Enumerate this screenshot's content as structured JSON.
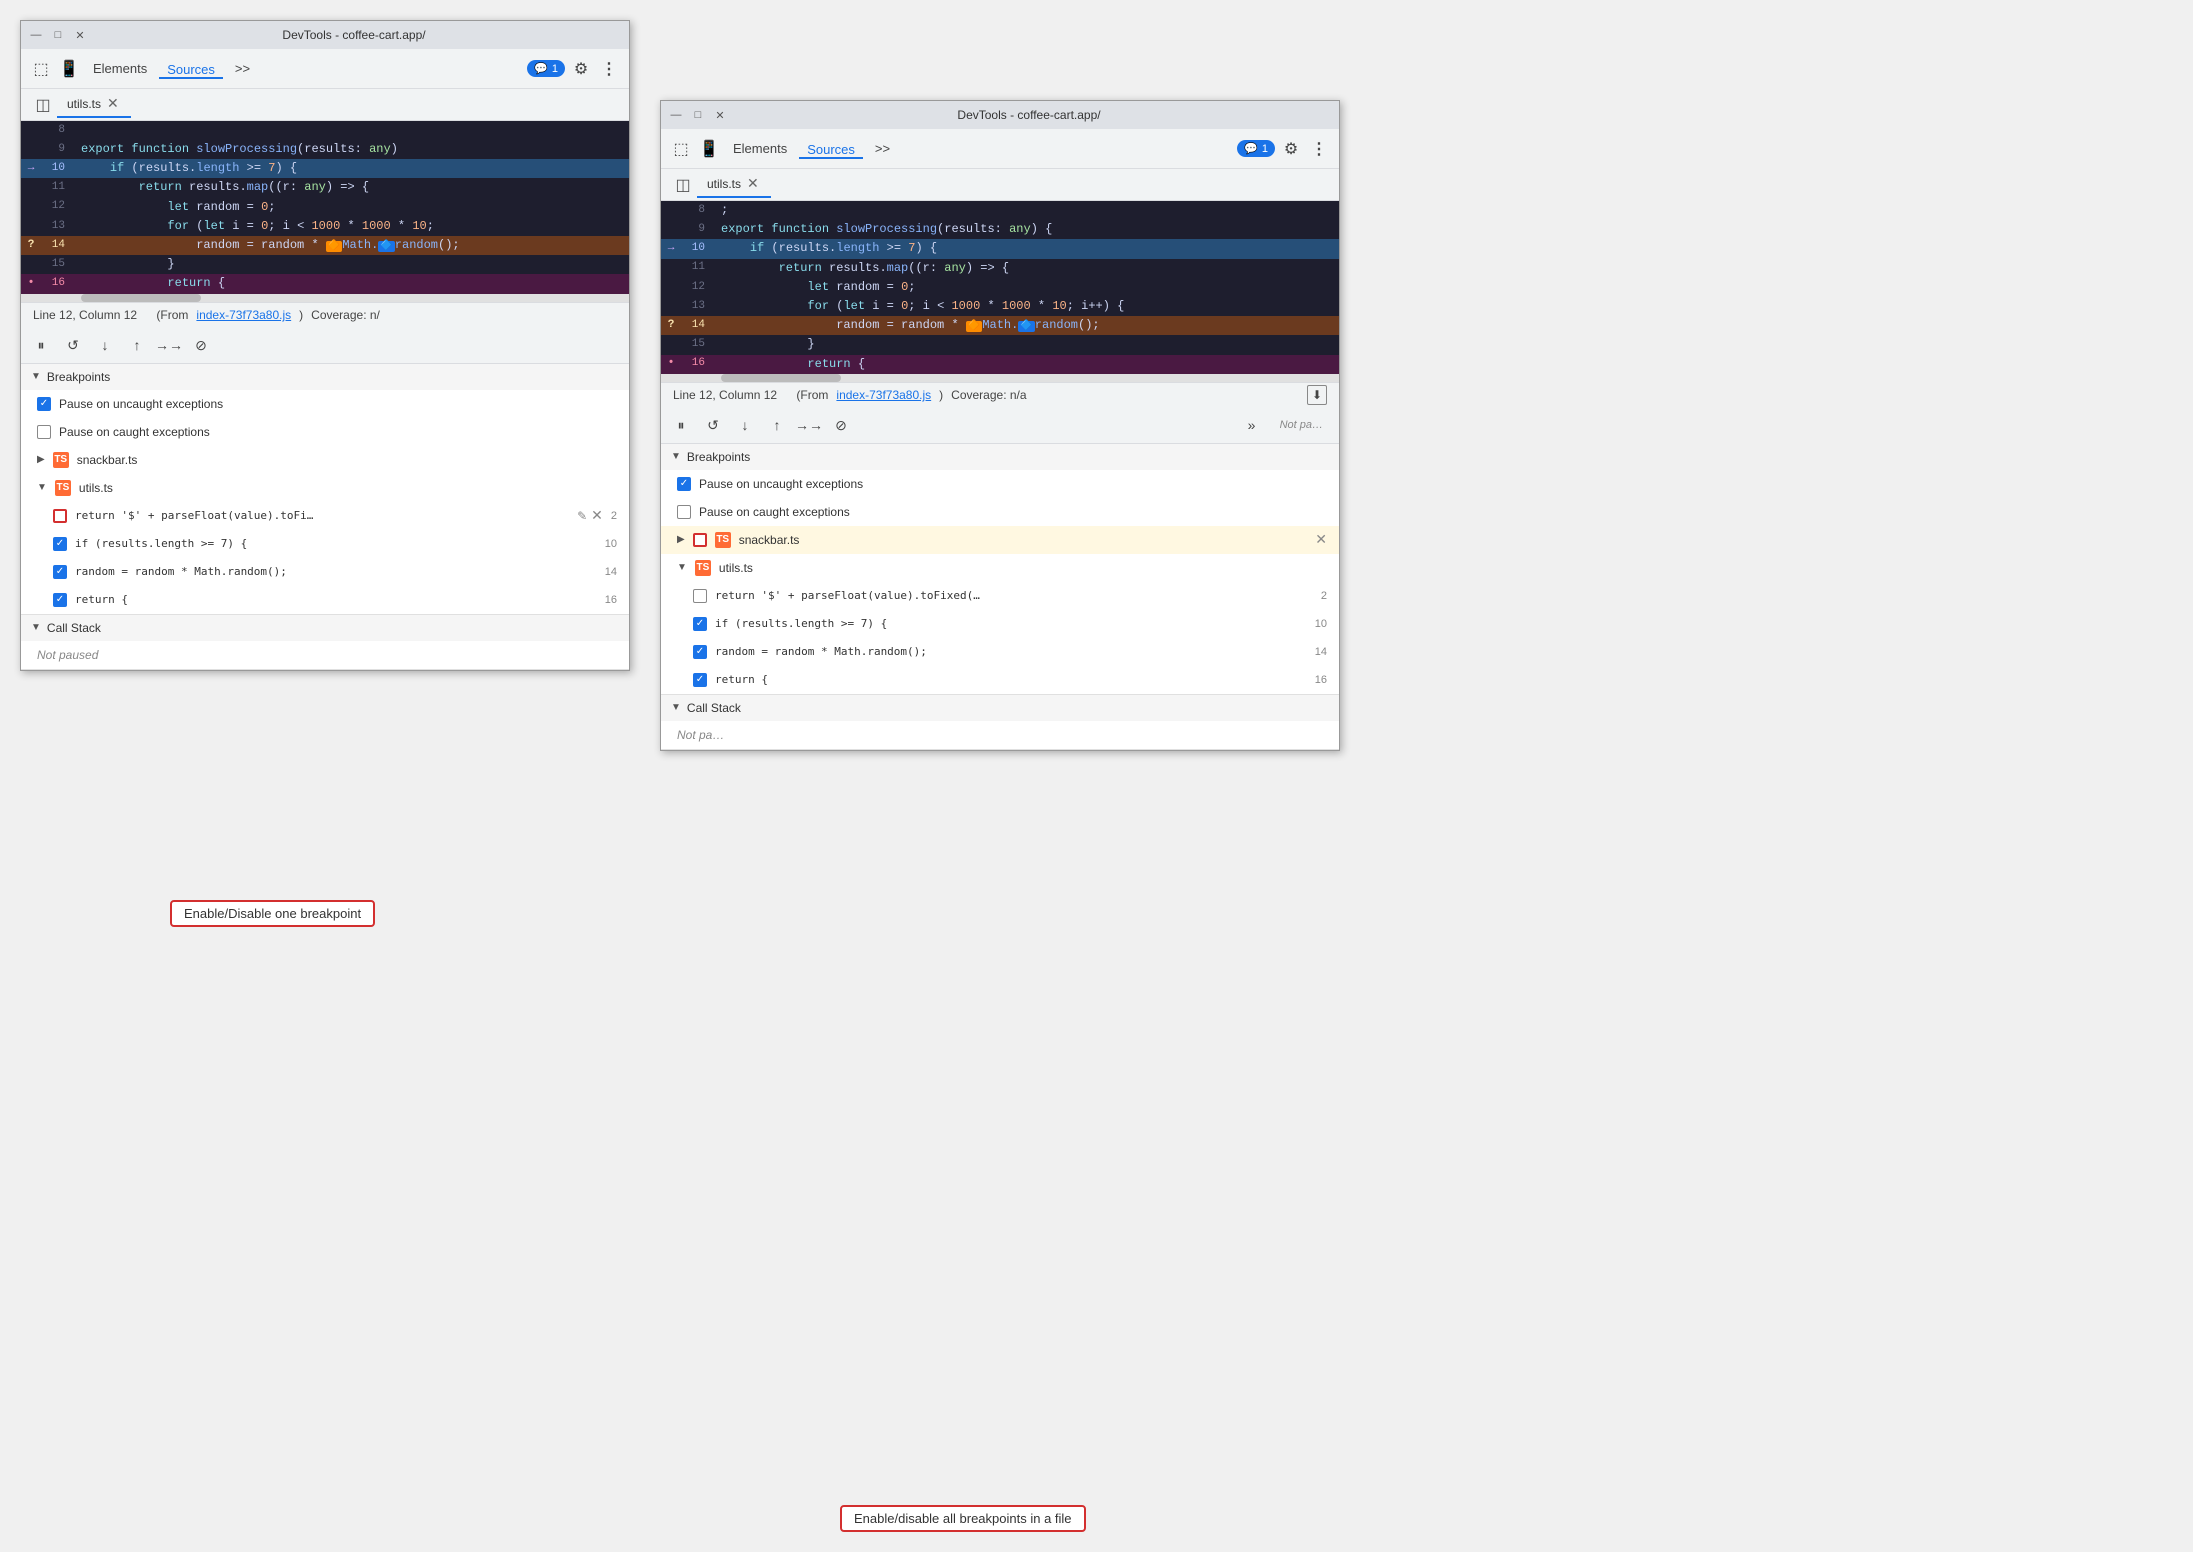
{
  "window1": {
    "title": "DevTools - coffee-cart.app/",
    "tabs": [
      "Elements",
      "Sources",
      ">>"
    ],
    "active_tab": "Sources",
    "file_tab": "utils.ts",
    "code_lines": [
      {
        "num": "8",
        "marker": "",
        "content": "",
        "highlight": "none"
      },
      {
        "num": "9",
        "marker": "",
        "content": "export function slowProcessing(results: any)",
        "highlight": "none"
      },
      {
        "num": "10",
        "marker": "→",
        "content": "    if (results.length >= 7) {",
        "highlight": "blue"
      },
      {
        "num": "11",
        "marker": "",
        "content": "        return results.map((r: any) => {",
        "highlight": "none"
      },
      {
        "num": "12",
        "marker": "",
        "content": "            let random = 0;",
        "highlight": "none"
      },
      {
        "num": "13",
        "marker": "",
        "content": "            for (let i = 0; i < 1000 * 1000 * 10;",
        "highlight": "none"
      },
      {
        "num": "14",
        "marker": "?",
        "content": "                random = random * 🔶Math.🔷random();",
        "highlight": "orange"
      },
      {
        "num": "15",
        "marker": "",
        "content": "            }",
        "highlight": "none"
      },
      {
        "num": "16",
        "marker": "•",
        "content": "            return {",
        "highlight": "pink"
      }
    ],
    "status_bar": {
      "position": "Line 12, Column 12",
      "source_link": "index-73f73a80.js",
      "coverage": "Coverage: n/"
    },
    "breakpoints_label": "Breakpoints",
    "pause_uncaught": "Pause on uncaught exceptions",
    "pause_caught": "Pause on caught exceptions",
    "snackbar_file": "snackbar.ts",
    "utils_file": "utils.ts",
    "bp_items": [
      {
        "text": "return '$' + parseFloat(value).toFi…",
        "line": "2",
        "checked": "outlined",
        "actions": true
      },
      {
        "text": "if (results.length >= 7) {",
        "line": "10",
        "checked": "checked"
      },
      {
        "text": "random = random * Math.random();",
        "line": "14",
        "checked": "checked"
      },
      {
        "text": "return {",
        "line": "16",
        "checked": "checked"
      }
    ],
    "call_stack_label": "Call Stack",
    "call_stack_sub": "Not paused"
  },
  "window2": {
    "title": "DevTools - coffee-cart.app/",
    "tabs": [
      "Elements",
      "Sources",
      ">>"
    ],
    "active_tab": "Sources",
    "file_tab": "utils.ts",
    "code_lines": [
      {
        "num": "8",
        "marker": "",
        "content": ";",
        "highlight": "none"
      },
      {
        "num": "9",
        "marker": "",
        "content": "export function slowProcessing(results: any) {",
        "highlight": "none"
      },
      {
        "num": "10",
        "marker": "→",
        "content": "    if (results.length >= 7) {",
        "highlight": "blue"
      },
      {
        "num": "11",
        "marker": "",
        "content": "        return results.map((r: any) => {",
        "highlight": "none"
      },
      {
        "num": "12",
        "marker": "",
        "content": "            let random = 0;",
        "highlight": "none"
      },
      {
        "num": "13",
        "marker": "",
        "content": "            for (let i = 0; i < 1000 * 1000 * 10; i++) {",
        "highlight": "none"
      },
      {
        "num": "14",
        "marker": "?",
        "content": "                random = random * 🔶Math.🔷random();",
        "highlight": "orange"
      },
      {
        "num": "15",
        "marker": "",
        "content": "            }",
        "highlight": "none"
      },
      {
        "num": "16",
        "marker": "•",
        "content": "            return {",
        "highlight": "pink"
      }
    ],
    "status_bar": {
      "position": "Line 12, Column 12",
      "source_link": "index-73f73a80.js",
      "coverage": "Coverage: n/a"
    },
    "breakpoints_label": "Breakpoints",
    "pause_uncaught": "Pause on uncaught exceptions",
    "pause_caught": "Pause on caught exceptions",
    "snackbar_file": "snackbar.ts",
    "utils_file": "utils.ts",
    "bp_items": [
      {
        "text": "return '$' + parseFloat(value).toFixed(…",
        "line": "2",
        "checked": "unchecked",
        "actions": false
      },
      {
        "text": "if (results.length >= 7) {",
        "line": "10",
        "checked": "checked"
      },
      {
        "text": "random = random * Math.random();",
        "line": "14",
        "checked": "checked"
      },
      {
        "text": "return {",
        "line": "16",
        "checked": "checked"
      }
    ],
    "call_stack_label": "Call Stack",
    "call_stack_sub": "Not pa…"
  },
  "tooltip1": "Enable/Disable one breakpoint",
  "tooltip2": "Enable/disable all breakpoints in a file",
  "icons": {
    "pause": "⏸",
    "refresh": "↺",
    "step_over": "↓",
    "step_into": "↑",
    "step_out": "→",
    "deactivate": "⊘",
    "chevron_down": "▼",
    "chevron_right": "▶",
    "close": "✕",
    "sidebar": "◫"
  }
}
